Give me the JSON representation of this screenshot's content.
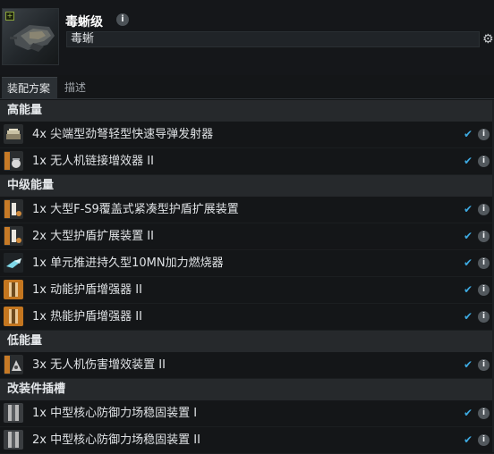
{
  "ship": {
    "title": "毒蜥级",
    "fitting_name": "毒蜥"
  },
  "tabs": [
    {
      "label": "装配方案",
      "active": true
    },
    {
      "label": "描述",
      "active": false
    }
  ],
  "sections": [
    {
      "title": "高能量",
      "items": [
        {
          "text": "4x 尖端型劲弩轻型快速导弹发射器",
          "icon": "launcher-icon",
          "online": true
        },
        {
          "text": "1x 无人机链接增效器 II",
          "icon": "drone-link-icon",
          "online": true
        }
      ]
    },
    {
      "title": "中级能量",
      "items": [
        {
          "text": "1x 大型F-S9覆盖式紧凑型护盾扩展装置",
          "icon": "shield-extender-icon",
          "online": true
        },
        {
          "text": "2x 大型护盾扩展装置 II",
          "icon": "shield-extender-icon",
          "online": true
        },
        {
          "text": "1x 单元推进持久型10MN加力燃烧器",
          "icon": "afterburner-icon",
          "online": true
        },
        {
          "text": "1x 动能护盾增强器 II",
          "icon": "shield-amplifier-icon",
          "online": true
        },
        {
          "text": "1x 热能护盾增强器 II",
          "icon": "shield-amplifier-icon",
          "online": true
        }
      ]
    },
    {
      "title": "低能量",
      "items": [
        {
          "text": "3x 无人机伤害增效装置 II",
          "icon": "drone-damage-icon",
          "online": true
        }
      ]
    },
    {
      "title": "改装件插槽",
      "items": [
        {
          "text": "1x 中型核心防御力场稳固装置 I",
          "icon": "rig-icon",
          "online": true
        },
        {
          "text": "2x 中型核心防御力场稳固装置 II",
          "icon": "rig-icon",
          "online": true
        }
      ]
    }
  ],
  "colors": {
    "check": "#3da9e0",
    "section_bg": "#26292c",
    "row_bg": "#141618"
  },
  "glyphs": {
    "check": "✔",
    "info": "i",
    "gear": "⚙",
    "plus": "+"
  }
}
